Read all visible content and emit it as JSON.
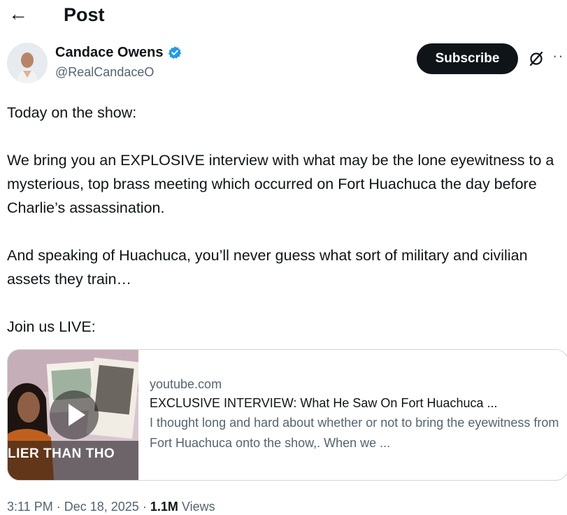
{
  "header": {
    "back_icon": "left-arrow-icon",
    "title": "Post"
  },
  "author": {
    "name": "Candace Owens",
    "handle": "@RealCandaceO",
    "verified_icon": "verified-badge-icon",
    "verified_color": "#1d9bf0"
  },
  "actions": {
    "subscribe_label": "Subscribe",
    "grok_icon": "slashed-circle-icon",
    "more_icon": "more-horizontal-icon"
  },
  "post": {
    "lines": [
      "Today on the show:",
      "We bring you an EXPLOSIVE interview with what may be the lone eyewitness to a mysterious, top brass meeting which occurred on Fort Huachuca the day before Charlie’s assassination.",
      "And speaking of Huachuca, you’ll never guess what sort of military and civilian assets they train…",
      "Join us LIVE:"
    ]
  },
  "link_card": {
    "thumbnail_caption": "LIER THAN THO",
    "play_icon": "play-icon",
    "domain": "youtube.com",
    "title": "EXCLUSIVE INTERVIEW: What He Saw On Fort Huachuca ...",
    "description": "I thought long and hard about whether or not to bring the eyewitness from Fort Huachuca onto the show,. When we ..."
  },
  "meta": {
    "time": "3:11 PM",
    "separator": "·",
    "date": "Dec 18, 2025",
    "views_count": "1.1M",
    "views_label": "Views"
  },
  "colors": {
    "text_primary": "#0f1419",
    "text_secondary": "#536471",
    "button_bg": "#0f1419",
    "border": "#cfd9de"
  }
}
